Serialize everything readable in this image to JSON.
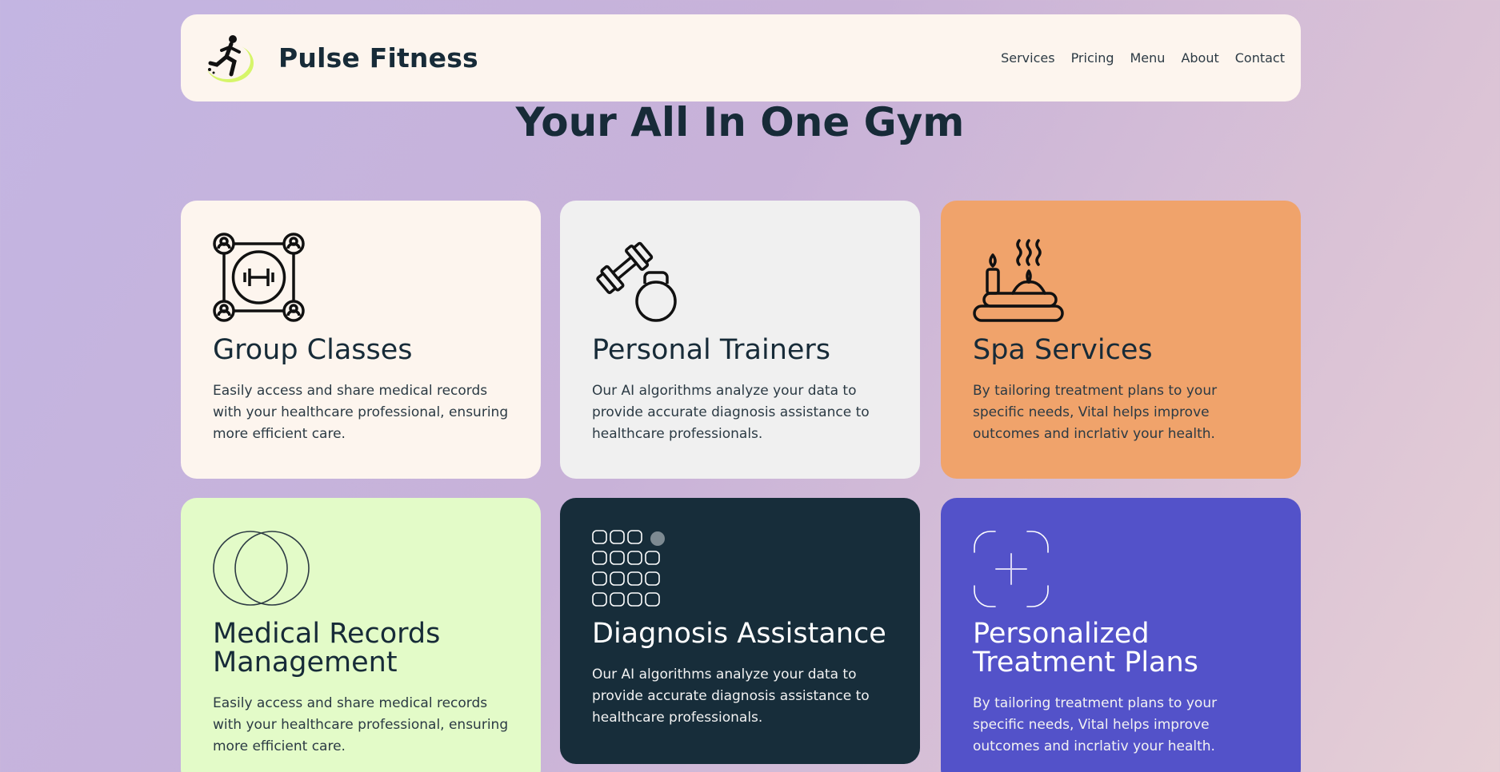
{
  "header": {
    "brand": "Pulse Fitness",
    "logo_icon": "runner-logo-icon",
    "nav": [
      "Services",
      "Pricing",
      "Menu",
      "About",
      "Contact"
    ]
  },
  "hero": {
    "title": "Your All In One Gym"
  },
  "cards": [
    {
      "title": "Group Classes",
      "text": "Easily access and share medical records with your healthcare professional, ensuring more efficient care.",
      "icon": "group-dumbbell-icon",
      "color": "#fdf5ee"
    },
    {
      "title": "Personal Trainers",
      "text": "Our AI algorithms analyze your data to provide accurate diagnosis assistance to healthcare professionals.",
      "icon": "dumbbell-kettlebell-icon",
      "color": "#f0f0f0"
    },
    {
      "title": "Spa Services",
      "text": "By tailoring treatment plans to your specific needs, Vital helps improve outcomes and incrlativ your health.",
      "icon": "spa-candle-icon",
      "color": "#f0a36b"
    },
    {
      "title": "Medical Records Management",
      "text": "Easily access and share medical records with your healthcare professional, ensuring more efficient care.",
      "icon": "overlapping-circles-icon",
      "color": "#e3fbc8"
    },
    {
      "title": "Diagnosis Assistance",
      "text": "Our AI algorithms analyze your data to provide accurate diagnosis assistance to healthcare professionals.",
      "icon": "dot-grid-icon",
      "color": "#172d3a"
    },
    {
      "title": "Personalized Treatment Plans",
      "text": "By tailoring treatment plans to your specific needs, Vital helps improve outcomes and incrlativ your health.",
      "icon": "crosshair-frame-icon",
      "color": "#5352c9"
    }
  ]
}
